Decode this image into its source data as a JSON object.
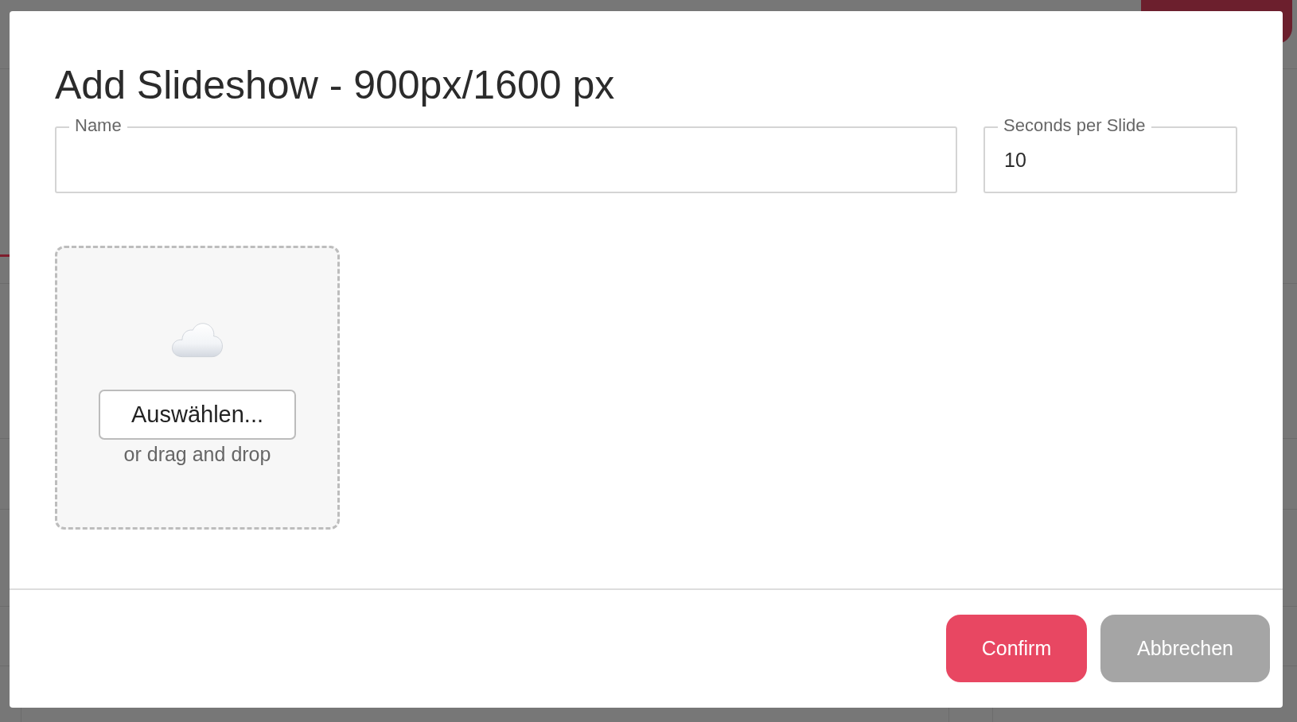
{
  "dialog": {
    "title": "Add Slideshow - 900px/1600 px",
    "fields": [
      {
        "label": "Name"
      },
      {
        "label": "Seconds per Slide",
        "value": "10"
      }
    ],
    "upload": {
      "button": "Auswählen...",
      "hint": "or drag and drop"
    },
    "actions": [
      {
        "label": "Confirm",
        "kind": "primary"
      },
      {
        "label": "Abbrechen",
        "kind": "secondary"
      }
    ]
  }
}
